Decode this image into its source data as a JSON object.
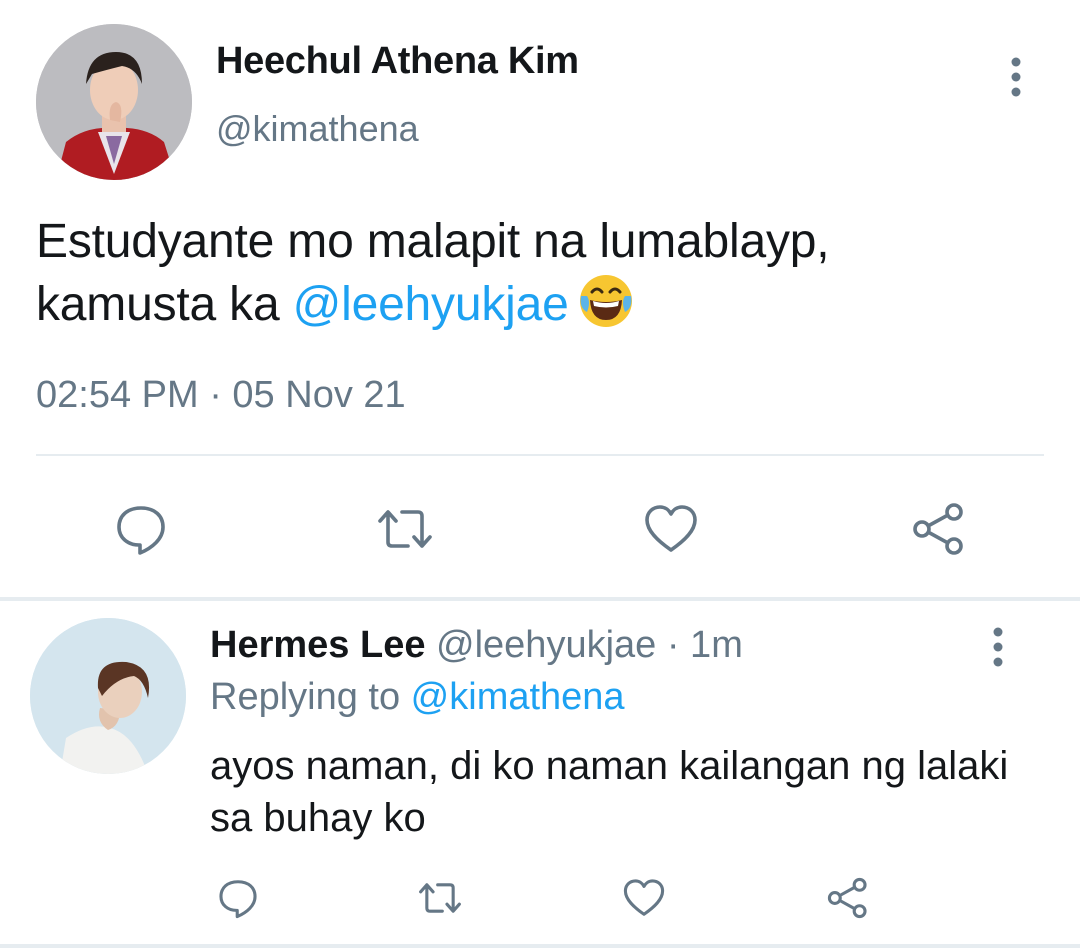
{
  "tweet": {
    "author_name": "Heechul Athena Kim",
    "author_handle": "@kimathena",
    "text_line1": "Estudyante mo malapit na lumablayp,",
    "text_line2_prefix": "kamusta ka ",
    "mention": "@leehyukjae",
    "timestamp": "02:54 PM · 05 Nov 21",
    "actions": [
      "reply-icon",
      "retweet-icon",
      "like-icon",
      "share-icon"
    ]
  },
  "reply": {
    "author_name": "Hermes Lee",
    "meta": " @leehyukjae · 1m",
    "replying_prefix": "Replying to ",
    "replying_to": "@kimathena",
    "text": "ayos naman, di ko naman kailangan ng lalaki sa buhay ko",
    "actions": [
      "reply-icon",
      "retweet-icon",
      "like-icon",
      "share-icon"
    ]
  },
  "colors": {
    "accent": "#1da1f2",
    "secondary_text": "#657786",
    "icon": "#657786",
    "divider": "#e6ecf0"
  }
}
